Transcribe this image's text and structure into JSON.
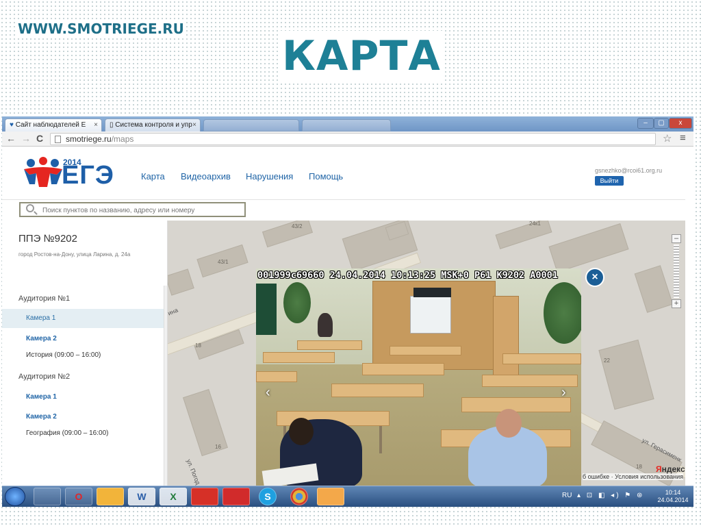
{
  "slide": {
    "url_text": "WWW.SMOTRIEGE.RU",
    "title": "КАРТА"
  },
  "browser": {
    "tabs": [
      {
        "label": "Сайт наблюдателей Е",
        "close": "×"
      },
      {
        "label": "Система контроля и упр",
        "close": "×"
      }
    ],
    "address": {
      "domain": "smotriege.ru",
      "path": "/maps"
    },
    "back_icon": "←",
    "forward_icon": "→",
    "reload_icon": "C",
    "star_icon": "☆",
    "menu_icon": "≡",
    "window_controls": {
      "minimize": "–",
      "maximize": "▢",
      "close": "x"
    }
  },
  "site": {
    "logo": {
      "year": "2014",
      "word": "ЕГЭ"
    },
    "nav": [
      "Карта",
      "Видеоархив",
      "Нарушения",
      "Помощь"
    ],
    "user_email": "gsnezhko@rcoi61.org.ru",
    "logout_label": "Выйти",
    "search_placeholder": "Поиск пунктов по названию, адресу или номеру"
  },
  "sidebar": {
    "ppe_title": "ППЭ №9202",
    "ppe_address": "город Ростов-на-Дону, улица Ларина, д. 24а",
    "auditoriums": [
      {
        "label": "Аудитория №1",
        "cameras": [
          "Камера 1",
          "Камера 2"
        ],
        "subject": "История (09:00 – 16:00)"
      },
      {
        "label": "Аудитория №2",
        "cameras": [
          "Камера 1",
          "Камера 2"
        ],
        "subject": "География (09:00 – 16:00)"
      }
    ],
    "selected_camera": "Камера 1"
  },
  "map": {
    "labels": [
      "43/2",
      "43/1",
      "24к1",
      "18",
      "22",
      "16",
      "18"
    ],
    "street_labels": [
      "ина",
      "ул. Погод",
      "ул. Герасименк"
    ],
    "zoom_minus": "–",
    "zoom_plus": "+",
    "yandex_logo": {
      "first": "Я",
      "rest": "ндекс"
    },
    "footer_text": "б ошибке · Условия использования"
  },
  "video": {
    "overlay_text": "001999c69660 24.04.2014 10:13:25 MSK+0 P61 K9202 A0001",
    "prev_icon": "‹",
    "next_icon": "›",
    "close_icon": "×"
  },
  "taskbar": {
    "apps": [
      "",
      "O",
      "",
      "W",
      "X",
      "",
      "",
      "S",
      "",
      ""
    ],
    "lang": "RU",
    "tray_icons": "▴ ⊡ ◧ ◂) ⚑ ⊛",
    "time": "10:14",
    "date": "24.04.2014"
  },
  "colors": {
    "accent": "#1e8096",
    "link": "#1f64a6",
    "logo_red": "#e52620",
    "logo_blue": "#1e5fa8"
  },
  "icons": [
    "start-orb-icon",
    "folder-icon",
    "opera-icon",
    "outlook-icon",
    "word-icon",
    "excel-icon",
    "pdf-icon",
    "media-icon",
    "skype-icon",
    "chrome-icon",
    "powerpoint-icon"
  ]
}
